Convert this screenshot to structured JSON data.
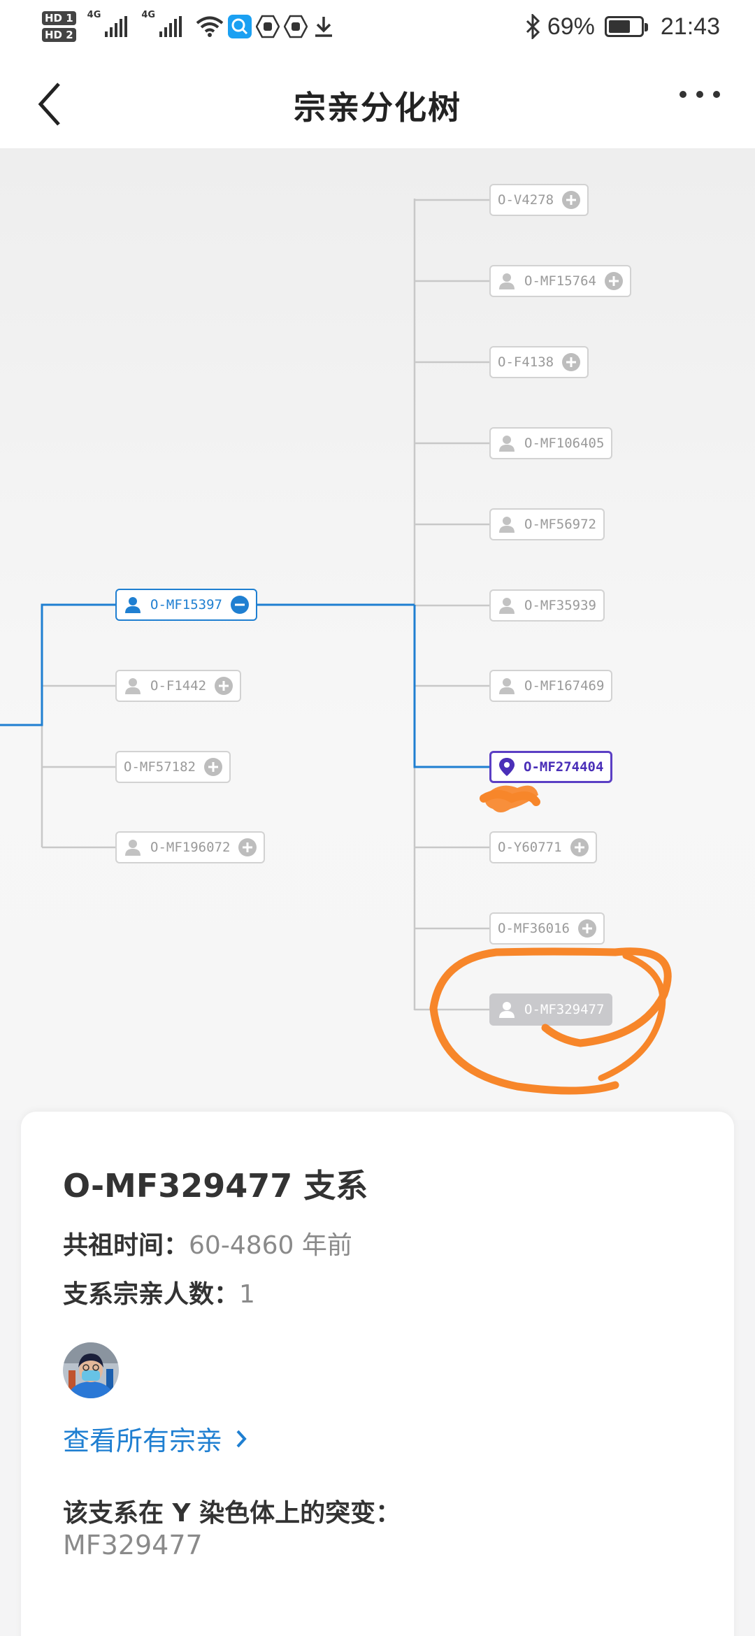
{
  "status_bar": {
    "hd1": "HD 1",
    "hd2": "HD 2",
    "network1": "4G",
    "network2": "4G",
    "battery": "69%",
    "battery_level": 0.69,
    "time": "21:43"
  },
  "header": {
    "title": "宗亲分化树"
  },
  "tree": {
    "left_nodes": [
      {
        "label": "O-MF15397",
        "state": "expanded"
      },
      {
        "label": "O-F1442",
        "state": "collapsed"
      },
      {
        "label": "O-MF57182",
        "state": "collapsed"
      },
      {
        "label": "O-MF196072",
        "state": "collapsed"
      }
    ],
    "right_nodes": [
      {
        "label": "O-V4278"
      },
      {
        "label": "O-MF15764"
      },
      {
        "label": "O-F4138"
      },
      {
        "label": "O-MF106405"
      },
      {
        "label": "O-MF56972"
      },
      {
        "label": "O-MF35939"
      },
      {
        "label": "O-MF167469"
      },
      {
        "label": "O-MF274404",
        "state": "current"
      },
      {
        "label": "O-Y60771"
      },
      {
        "label": "O-MF36016"
      },
      {
        "label": "O-MF329477",
        "state": "selected"
      }
    ]
  },
  "detail": {
    "title": "O-MF329477 支系",
    "ancestor_label": "共祖时间：",
    "ancestor_value": "60-4860 年前",
    "count_label": "支系宗亲人数：",
    "count_value": "1",
    "view_all": "查看所有宗亲",
    "mutation_label": "该支系在 Y 染色体上的突变：",
    "mutation_value": "MF329477"
  },
  "colors": {
    "accent": "#1f7fd1",
    "current": "#5b3fc4",
    "line": "#c8c8c8",
    "annotation": "#f7862a"
  }
}
